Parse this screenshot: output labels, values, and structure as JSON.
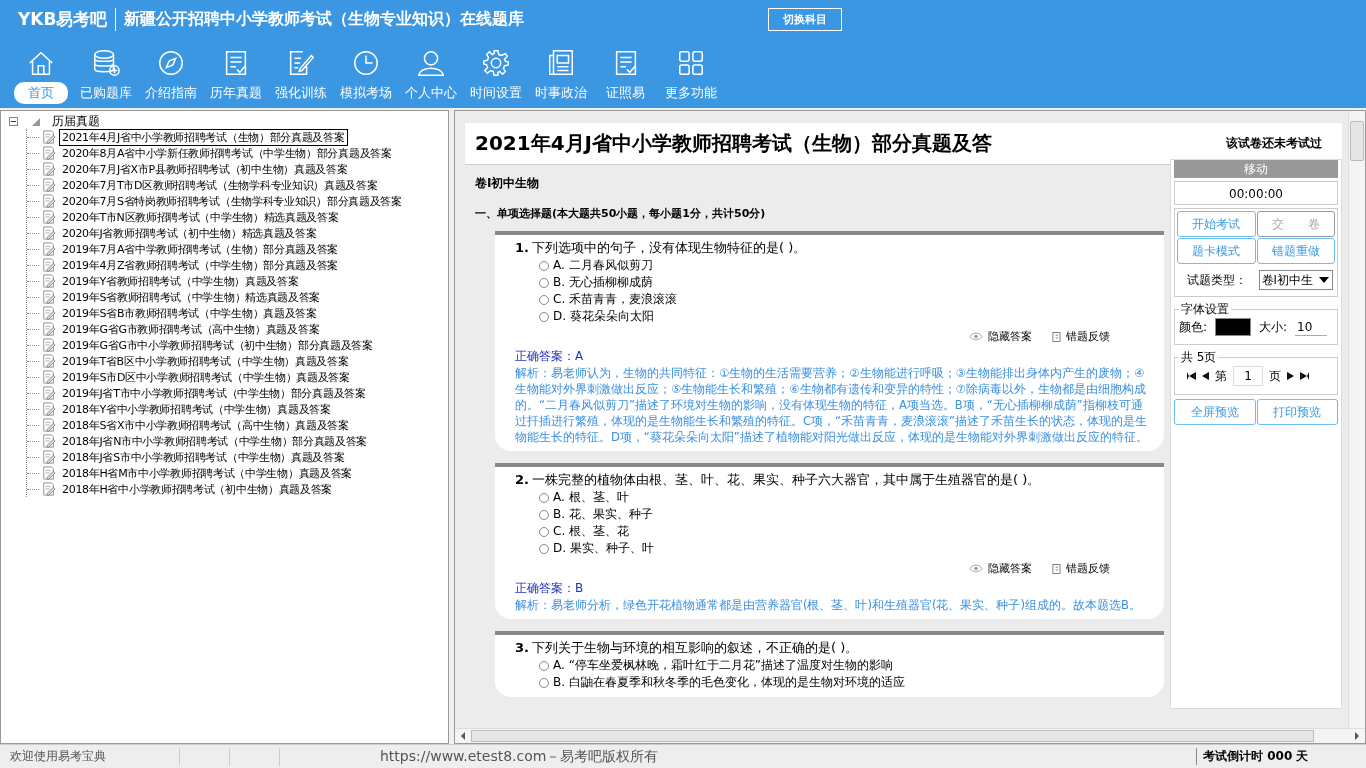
{
  "header": {
    "logo": "YKB易考吧",
    "title": "新疆公开招聘中小学教师考试（生物专业知识）在线题库",
    "switch_button": "切换科目"
  },
  "nav": [
    {
      "label": "首页",
      "kind": "home",
      "selected": true
    },
    {
      "label": "已购题库",
      "kind": "database",
      "selected": false
    },
    {
      "label": "介绍指南",
      "kind": "compass",
      "selected": false
    },
    {
      "label": "历年真题",
      "kind": "list",
      "selected": false
    },
    {
      "label": "强化训练",
      "kind": "edit",
      "selected": false
    },
    {
      "label": "模拟考场",
      "kind": "clock",
      "selected": false
    },
    {
      "label": "个人中心",
      "kind": "user",
      "selected": false
    },
    {
      "label": "时间设置",
      "kind": "gear",
      "selected": false
    },
    {
      "label": "时事政治",
      "kind": "news",
      "selected": false
    },
    {
      "label": "证照易",
      "kind": "list",
      "selected": false
    },
    {
      "label": "更多功能",
      "kind": "grid",
      "selected": false
    }
  ],
  "tree": {
    "label": "历届真题",
    "expanded": true,
    "children": [
      {
        "label": "2021年4月J省中小学教师招聘考试（生物）部分真题及答案",
        "selected": true
      },
      {
        "label": "2020年8月A省中小学新任教师招聘考试（中学生物）部分真题及答案",
        "selected": false
      },
      {
        "label": "2020年7月J省X市P县教师招聘考试（初中生物）真题及答案",
        "selected": false
      },
      {
        "label": "2020年7月T市D区教师招聘考试（生物学科专业知识）真题及答案",
        "selected": false
      },
      {
        "label": "2020年7月S省特岗教师招聘考试（生物学科专业知识）部分真题及答案",
        "selected": false
      },
      {
        "label": "2020年T市N区教师招聘考试（中学生物）精选真题及答案",
        "selected": false
      },
      {
        "label": "2020年J省教师招聘考试（初中生物）精选真题及答案",
        "selected": false
      },
      {
        "label": "2019年7月A省中学教师招聘考试（生物）部分真题及答案",
        "selected": false
      },
      {
        "label": "2019年4月Z省教师招聘考试（中学生物）部分真题及答案",
        "selected": false
      },
      {
        "label": "2019年Y省教师招聘考试（中学生物）真题及答案",
        "selected": false
      },
      {
        "label": "2019年S省教师招聘考试（中学生物）精选真题及答案",
        "selected": false
      },
      {
        "label": "2019年S省B市教师招聘考试（中学生物）真题及答案",
        "selected": false
      },
      {
        "label": "2019年G省G市教师招聘考试（高中生物）真题及答案",
        "selected": false
      },
      {
        "label": "2019年G省G市中小学教师招聘考试（初中生物）部分真题及答案",
        "selected": false
      },
      {
        "label": "2019年T省B区中小学教师招聘考试（中学生物）真题及答案",
        "selected": false
      },
      {
        "label": "2019年S市D区中小学教师招聘考试（中学生物）真题及答案",
        "selected": false
      },
      {
        "label": "2019年J省T市中小学教师招聘考试（中学生物）部分真题及答案",
        "selected": false
      },
      {
        "label": "2018年Y省中小学教师招聘考试（中学生物）真题及答案",
        "selected": false
      },
      {
        "label": "2018年S省X市中小学教师招聘考试（高中生物）真题及答案",
        "selected": false
      },
      {
        "label": "2018年J省N市中小学教师招聘考试（中学生物）部分真题及答案",
        "selected": false
      },
      {
        "label": "2018年J省S市中小学教师招聘考试（中学生物）真题及答案",
        "selected": false
      },
      {
        "label": "2018年H省M市中小学教师招聘考试（中学生物）真题及答案",
        "selected": false
      },
      {
        "label": "2018年H省中小学教师招聘考试（初中生物）真题及答案",
        "selected": false
      }
    ]
  },
  "paper": {
    "title": "2021年4月J省中小学教师招聘考试（生物）部分真题及答",
    "status": "该试卷还未考试过",
    "volume": "卷Ⅰ初中生物",
    "section": "一、单项选择题(本大题共50小题，每小题1分，共计50分)",
    "questions": [
      {
        "number": "1.",
        "text": "下列选项中的句子，没有体现生物特征的是( )。",
        "options": [
          {
            "label": "A. 二月春风似剪刀",
            "selected": false
          },
          {
            "label": "B. 无心插柳柳成荫",
            "selected": false
          },
          {
            "label": "C. 禾苗青青，麦浪滚滚",
            "selected": false
          },
          {
            "label": "D. 葵花朵朵向太阳",
            "selected": false
          }
        ],
        "hide_answer": "隐藏答案",
        "feedback": "错题反馈",
        "answer": "正确答案：A",
        "analysis": "解析：易老师认为，生物的共同特征：①生物的生活需要营养；②生物能进行呼吸；③生物能排出身体内产生的废物；④生物能对外界刺激做出反应；⑤生物能生长和繁殖；⑥生物都有遗传和变异的特性；⑦除病毒以外，生物都是由细胞构成的。“二月春风似剪刀”描述了环境对生物的影响，没有体现生物的特征，A项当选。B项，“无心插柳柳成荫”指柳枝可通过扦插进行繁殖，体现的是生物能生长和繁殖的特征。C项，“禾苗青青，麦浪滚滚”描述了禾苗生长的状态，体现的是生物能生长的特征。D项，“葵花朵朵向太阳”描述了植物能对阳光做出反应，体现的是生物能对外界刺激做出反应的特征。"
      },
      {
        "number": "2.",
        "text": "一株完整的植物体由根、茎、叶、花、果实、种子六大器官，其中属于生殖器官的是( )。",
        "options": [
          {
            "label": "A. 根、茎、叶",
            "selected": false
          },
          {
            "label": "B. 花、果实、种子",
            "selected": false
          },
          {
            "label": "C. 根、茎、花",
            "selected": false
          },
          {
            "label": "D. 果实、种子、叶",
            "selected": false
          }
        ],
        "hide_answer": "隐藏答案",
        "feedback": "错题反馈",
        "answer": "正确答案：B",
        "analysis": "解析：易老师分析，绿色开花植物通常都是由营养器官(根、茎、叶)和生殖器官(花、果实、种子)组成的。故本题选B。"
      },
      {
        "number": "3.",
        "text": "下列关于生物与环境的相互影响的叙述，不正确的是( )。",
        "options": [
          {
            "label": "A. “停车坐爱枫林晚，霜叶红于二月花”描述了温度对生物的影响",
            "selected": false
          },
          {
            "label": "B. 白鼬在春夏季和秋冬季的毛色变化，体现的是生物对环境的适应",
            "selected": false
          }
        ]
      }
    ]
  },
  "panel": {
    "title": "移动",
    "timer": "00:00:00",
    "buttons": [
      {
        "label": "开始考试",
        "disabled": false
      },
      {
        "label": "交　　卷",
        "disabled": true
      },
      {
        "label": "题卡模式",
        "disabled": false
      },
      {
        "label": "错题重做",
        "disabled": false
      }
    ],
    "type_label": "试题类型：",
    "type_value": "卷Ⅰ初中生",
    "font_legend": "字体设置",
    "color_label": "颜色:",
    "size_label": "大小:",
    "size_value": "10",
    "pages_legend": "共 5页",
    "page_prefix": "第",
    "page_value": "1",
    "page_suffix": "页",
    "preview_buttons": [
      "全屏预览",
      "打印预览"
    ]
  },
  "status_bar": {
    "welcome": "欢迎使用易考宝典",
    "copyright": "https://www.etest8.com－易考吧版权所有",
    "countdown": "考试倒计时 000 天"
  }
}
